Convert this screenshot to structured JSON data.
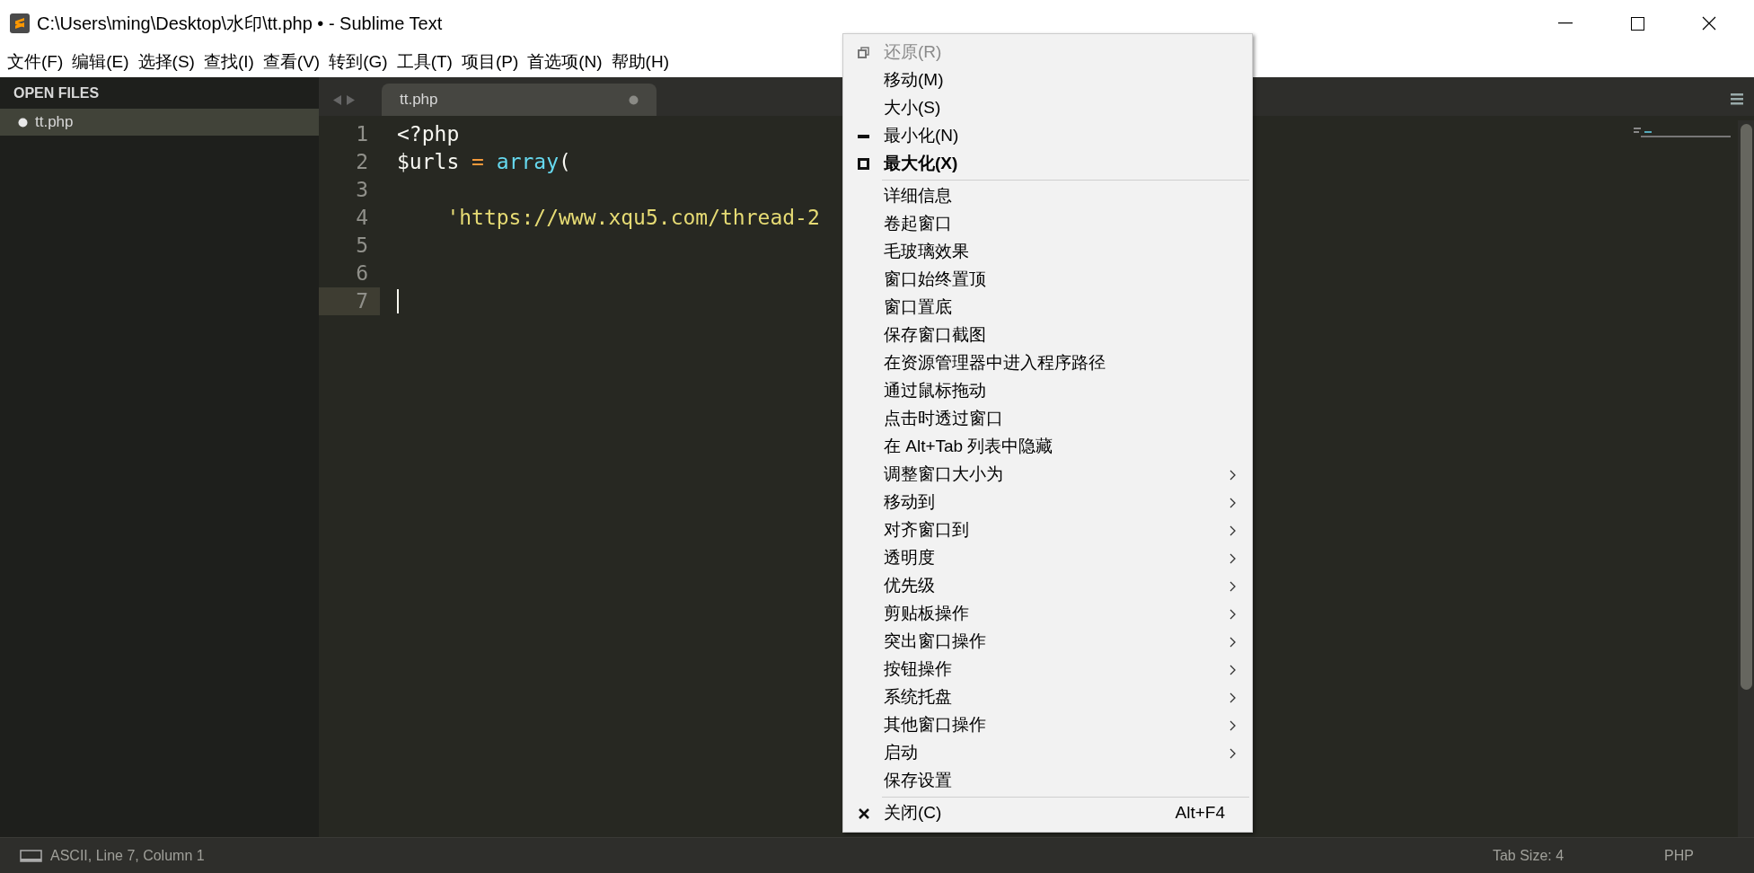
{
  "window": {
    "title": "C:\\Users\\ming\\Desktop\\水印\\tt.php • - Sublime Text"
  },
  "menu_bar": [
    "文件(F)",
    "编辑(E)",
    "选择(S)",
    "查找(I)",
    "查看(V)",
    "转到(G)",
    "工具(T)",
    "项目(P)",
    "首选项(N)",
    "帮助(H)"
  ],
  "sidebar": {
    "header": "OPEN FILES",
    "files": [
      {
        "name": "tt.php",
        "selected": true,
        "modified": true
      }
    ]
  },
  "tabs": [
    {
      "label": "tt.php",
      "selected": true,
      "modified": true
    }
  ],
  "editor": {
    "lines": [
      {
        "number": "1",
        "current": false,
        "tokens": [
          {
            "text": "<?php",
            "color": "#f8f8f2"
          }
        ]
      },
      {
        "number": "2",
        "current": false,
        "tokens": [
          {
            "text": "$urls ",
            "color": "#f8f8f2"
          },
          {
            "text": "= ",
            "color": "#f59a3b"
          },
          {
            "text": "array",
            "color": "#66d9ef"
          },
          {
            "text": "(",
            "color": "#f8f8f2"
          }
        ]
      },
      {
        "number": "3",
        "current": false
      },
      {
        "number": "4",
        "current": false,
        "tokens": [
          {
            "text": "    'https://www.xqu5.com/thread-2",
            "color": "#e6db74"
          }
        ]
      },
      {
        "number": "5",
        "current": false
      },
      {
        "number": "6",
        "current": false
      },
      {
        "number": "7",
        "current": true
      }
    ]
  },
  "context_menu": {
    "items": [
      {
        "kind": "restore",
        "label": "还原(R)",
        "disabled": true,
        "bold": false,
        "submenu": false
      },
      {
        "kind": "item",
        "label": "移动(M)",
        "disabled": false,
        "bold": false,
        "submenu": false
      },
      {
        "kind": "item",
        "label": "大小(S)",
        "disabled": false,
        "bold": false,
        "submenu": false
      },
      {
        "kind": "minimize",
        "label": "最小化(N)",
        "disabled": false,
        "bold": false,
        "submenu": false
      },
      {
        "kind": "maximize",
        "label": "最大化(X)",
        "disabled": false,
        "bold": true,
        "submenu": false
      },
      {
        "kind": "separator"
      },
      {
        "kind": "item",
        "label": "详细信息",
        "disabled": false,
        "bold": false,
        "submenu": false
      },
      {
        "kind": "item",
        "label": "卷起窗口",
        "disabled": false,
        "bold": false,
        "submenu": false
      },
      {
        "kind": "item",
        "label": "毛玻璃效果",
        "disabled": false,
        "bold": false,
        "submenu": false
      },
      {
        "kind": "item",
        "label": "窗口始终置顶",
        "disabled": false,
        "bold": false,
        "submenu": false
      },
      {
        "kind": "item",
        "label": "窗口置底",
        "disabled": false,
        "bold": false,
        "submenu": false
      },
      {
        "kind": "item",
        "label": "保存窗口截图",
        "disabled": false,
        "bold": false,
        "submenu": false
      },
      {
        "kind": "item",
        "label": "在资源管理器中进入程序路径",
        "disabled": false,
        "bold": false,
        "submenu": false
      },
      {
        "kind": "item",
        "label": "通过鼠标拖动",
        "disabled": false,
        "bold": false,
        "submenu": false
      },
      {
        "kind": "item",
        "label": "点击时透过窗口",
        "disabled": false,
        "bold": false,
        "submenu": false
      },
      {
        "kind": "item",
        "label": "在 Alt+Tab 列表中隐藏",
        "disabled": false,
        "bold": false,
        "submenu": false
      },
      {
        "kind": "item",
        "label": "调整窗口大小为",
        "disabled": false,
        "bold": false,
        "submenu": true
      },
      {
        "kind": "item",
        "label": "移动到",
        "disabled": false,
        "bold": false,
        "submenu": true
      },
      {
        "kind": "item",
        "label": "对齐窗口到",
        "disabled": false,
        "bold": false,
        "submenu": true
      },
      {
        "kind": "item",
        "label": "透明度",
        "disabled": false,
        "bold": false,
        "submenu": true
      },
      {
        "kind": "item",
        "label": "优先级",
        "disabled": false,
        "bold": false,
        "submenu": true
      },
      {
        "kind": "item",
        "label": "剪贴板操作",
        "disabled": false,
        "bold": false,
        "submenu": true
      },
      {
        "kind": "item",
        "label": "突出窗口操作",
        "disabled": false,
        "bold": false,
        "submenu": true
      },
      {
        "kind": "item",
        "label": "按钮操作",
        "disabled": false,
        "bold": false,
        "submenu": true
      },
      {
        "kind": "item",
        "label": "系统托盘",
        "disabled": false,
        "bold": false,
        "submenu": true
      },
      {
        "kind": "item",
        "label": "其他窗口操作",
        "disabled": false,
        "bold": false,
        "submenu": true
      },
      {
        "kind": "item",
        "label": "启动",
        "disabled": false,
        "bold": false,
        "submenu": true
      },
      {
        "kind": "item",
        "label": "保存设置",
        "disabled": false,
        "bold": false,
        "submenu": false
      },
      {
        "kind": "separator"
      },
      {
        "kind": "close",
        "label": "关闭(C)",
        "shortcut": "Alt+F4",
        "disabled": false,
        "bold": false,
        "submenu": false
      }
    ]
  },
  "status_bar": {
    "encoding": "ASCII, Line 7, Column 1",
    "tab_size": "Tab Size: 4",
    "syntax": "PHP"
  }
}
